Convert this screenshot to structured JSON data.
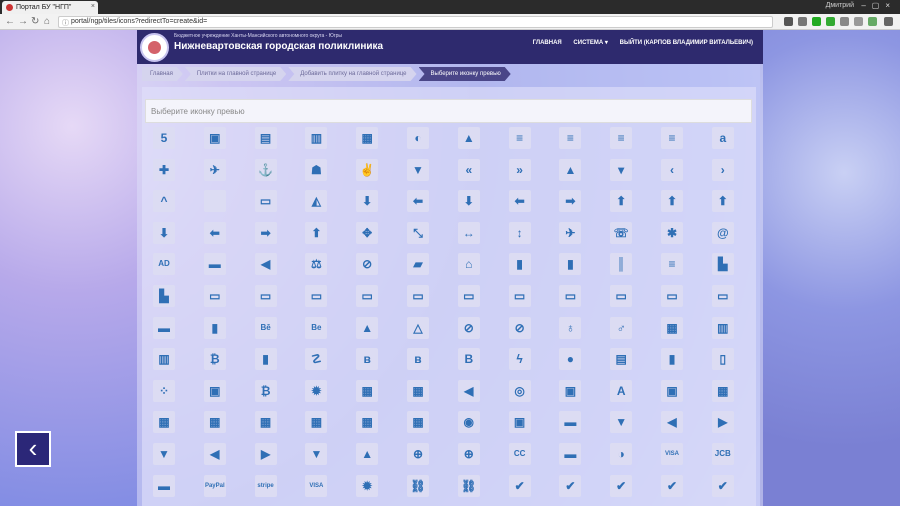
{
  "browser": {
    "tab_title": "Портал БУ \"НГП\"",
    "user_name": "Дмитрий",
    "url": "portal/ngp/tiles/icons?redirectTo=create&id="
  },
  "header": {
    "subtitle": "Бюджетное учреждение Ханты-Мансийского автономного округа - Югры",
    "title": "Нижневартовская городская поликлиника",
    "menu": [
      "ГЛАВНАЯ",
      "СИСТЕМА ▾",
      "ВЫЙТИ (КАРПОВ ВЛАДИМИР ВИТАЛЬЕВИЧ)"
    ]
  },
  "breadcrumbs": [
    "Главная",
    "Плитки на главной странице",
    "Добавить плитку на главной странице",
    "Выберите иконку превью"
  ],
  "search": {
    "placeholder": "Выберите иконку превью"
  },
  "icons": [
    [
      "5",
      "▣",
      "▤",
      "▥",
      "▦",
      "◐",
      "▲",
      "≡",
      "≡",
      "≡",
      "≡",
      "a"
    ],
    [
      "✚",
      "✈",
      "⚓",
      "☗",
      "✌",
      "▼",
      "«",
      "»",
      "▲",
      "▾",
      "‹",
      "›"
    ],
    [
      "^",
      "",
      "▭",
      "◭",
      "⬇",
      "⬅",
      "⬇",
      "⬅",
      "➡",
      "⬆",
      "⬆",
      "⬆"
    ],
    [
      "⬇",
      "⬅",
      "➡",
      "⬆",
      "✥",
      "⤡",
      "↔",
      "↕",
      "✈",
      "☏",
      "✱",
      "@"
    ],
    [
      "AD",
      "▬",
      "◀",
      "⚖",
      "⊘",
      "▰",
      "⌂",
      "▮",
      "▮",
      "║",
      "≡",
      "▙"
    ],
    [
      "▙",
      "▭",
      "▭",
      "▭",
      "▭",
      "▭",
      "▭",
      "▭",
      "▭",
      "▭",
      "▭",
      "▭"
    ],
    [
      "▬",
      "▮",
      "Bē",
      "Be",
      "▲",
      "△",
      "⊘",
      "⊘",
      "♁",
      "♂",
      "▦",
      "▥"
    ],
    [
      "▥",
      "₿",
      "▮",
      "☡",
      "ʙ",
      "ʙ",
      "B",
      "ϟ",
      "●",
      "▤",
      "▮",
      "▯"
    ],
    [
      "⁘",
      "▣",
      "₿",
      "✹",
      "▦",
      "▦",
      "◀",
      "◎",
      "▣",
      "A",
      "▣",
      "▦"
    ],
    [
      "▦",
      "▦",
      "▦",
      "▦",
      "▦",
      "▦",
      "◉",
      "▣",
      "▬",
      "▼",
      "◀",
      "▶"
    ],
    [
      "▼",
      "◀",
      "▶",
      "▼",
      "▲",
      "⊕",
      "⊕",
      "CC",
      "▬",
      "◑",
      "VISA",
      "JCB"
    ],
    [
      "▬",
      "PayPal",
      "stripe",
      "VISA",
      "✹",
      "⛓",
      "⛓",
      "✔",
      "✔",
      "✔",
      "✔",
      "✔"
    ]
  ],
  "prev_arrow": "‹"
}
